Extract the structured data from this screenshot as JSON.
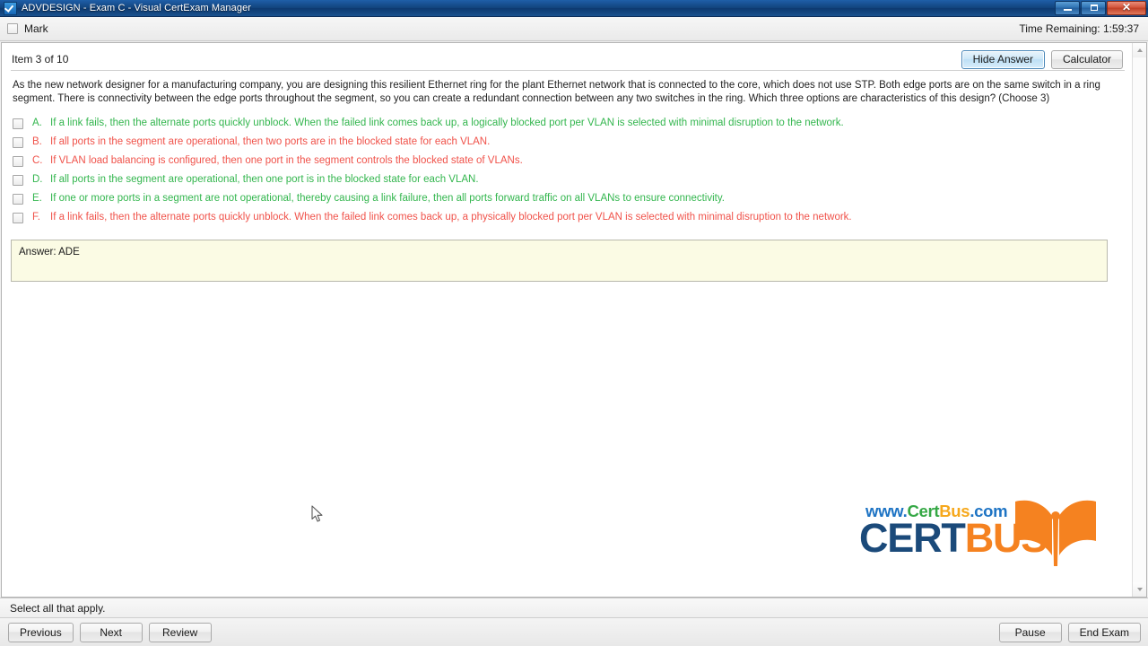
{
  "window": {
    "title": "ADVDESIGN - Exam C - Visual CertExam Manager",
    "icon": "checkbox-icon",
    "minimize_label": "",
    "maximize_label": "",
    "close_label": "✕"
  },
  "markbar": {
    "mark_label": "Mark",
    "mark_checked": false,
    "time_remaining": "Time Remaining: 1:59:37"
  },
  "header": {
    "item_label": "Item 3 of 10",
    "hide_answer_label": "Hide Answer",
    "calculator_label": "Calculator"
  },
  "question": {
    "text": "As the new network designer for a manufacturing company, you are designing this resilient Ethernet ring for the plant Ethernet network that is connected to the core, which does not use STP. Both edge ports are on the same switch in a ring segment. There is connectivity between the edge ports throughout the segment, so you can create a redundant connection between any two switches in the ring. Which three options are characteristics of this design? (Choose 3)"
  },
  "options": [
    {
      "letter": "A.",
      "text": "If a link fails, then the alternate ports quickly unblock. When the failed link comes back up, a logically blocked port per VLAN is selected with minimal disruption to the network.",
      "state": "correct",
      "checked": false
    },
    {
      "letter": "B.",
      "text": "If all ports in the segment are operational, then two ports are in the blocked state for each VLAN.",
      "state": "wrong",
      "checked": false
    },
    {
      "letter": "C.",
      "text": "If VLAN load balancing is configured, then one port in the segment controls the blocked state of VLANs.",
      "state": "wrong",
      "checked": false
    },
    {
      "letter": "D.",
      "text": "If all ports in the segment are operational, then one port is in the blocked state for each VLAN.",
      "state": "correct",
      "checked": false
    },
    {
      "letter": "E.",
      "text": "If one or more ports in a segment are not operational, thereby causing a link failure, then all ports forward traffic on all VLANs to ensure connectivity.",
      "state": "correct",
      "checked": false
    },
    {
      "letter": "F.",
      "text": "If a link fails, then the alternate ports quickly unblock. When the failed link comes back up, a physically blocked port per VLAN is selected with minimal disruption to the network.",
      "state": "wrong",
      "checked": false
    }
  ],
  "answer": {
    "text": "Answer: ADE"
  },
  "logo": {
    "url_www": "www.",
    "url_cert": "Cert",
    "url_bus": "Bus",
    "url_com": ".com",
    "main_cert": "CERT",
    "main_bus": "BUS"
  },
  "status": {
    "text": "Select all that apply."
  },
  "bottom": {
    "previous_label": "Previous",
    "next_label": "Next",
    "review_label": "Review",
    "pause_label": "Pause",
    "end_exam_label": "End Exam"
  },
  "colors": {
    "correct": "#33b64e",
    "wrong": "#f0524a",
    "titlebar": "#12447e",
    "answer_box_bg": "#fbfbe4",
    "logo_blue": "#1e74c4",
    "logo_green": "#35a845",
    "logo_yellow": "#f6a81c",
    "logo_navy": "#1b4a7a",
    "logo_orange": "#f58220"
  }
}
